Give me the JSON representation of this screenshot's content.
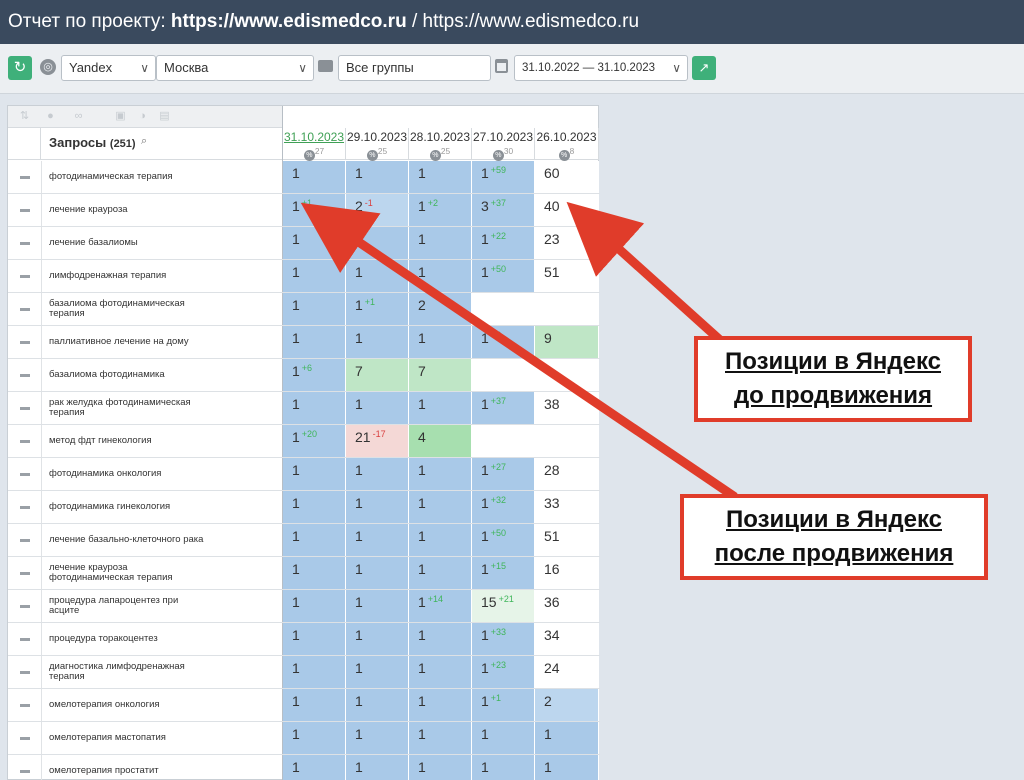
{
  "header": {
    "prefix": "Отчет по проекту: ",
    "project_bold": "https://www.edismedco.ru",
    "separator": " / ",
    "project_plain": "https://www.edismedco.ru"
  },
  "toolbar": {
    "search_engine": "Yandex",
    "region": "Москва",
    "group": "Все группы",
    "date_range": "31.10.2022 — 31.10.2023"
  },
  "table": {
    "queries_title": "Запросы",
    "queries_count": "(251)",
    "dates": [
      {
        "date": "31.10.2023",
        "pct": "27"
      },
      {
        "date": "29.10.2023",
        "pct": "25"
      },
      {
        "date": "28.10.2023",
        "pct": "25"
      },
      {
        "date": "27.10.2023",
        "pct": "30"
      },
      {
        "date": "26.10.2023",
        "pct": "8"
      }
    ],
    "rows": [
      {
        "query": "фотодинамическая терапия",
        "cells": [
          {
            "v": "1",
            "c": "b"
          },
          {
            "v": "1",
            "c": "b"
          },
          {
            "v": "1",
            "c": "b"
          },
          {
            "v": "1",
            "d": "+59",
            "c": "b"
          },
          {
            "v": "60",
            "c": "w"
          }
        ]
      },
      {
        "query": "лечение крауроза",
        "cells": [
          {
            "v": "1",
            "d": "+1",
            "c": "b"
          },
          {
            "v": "2",
            "d": "-1",
            "c": "lb"
          },
          {
            "v": "1",
            "d": "+2",
            "c": "b"
          },
          {
            "v": "3",
            "d": "+37",
            "c": "b"
          },
          {
            "v": "40",
            "c": "w"
          }
        ]
      },
      {
        "query": "лечение базалиомы",
        "cells": [
          {
            "v": "1",
            "c": "b"
          },
          {
            "v": "1",
            "c": "b"
          },
          {
            "v": "1",
            "c": "b"
          },
          {
            "v": "1",
            "d": "+22",
            "c": "b"
          },
          {
            "v": "23",
            "c": "w"
          }
        ]
      },
      {
        "query": "лимфодренажная терапия",
        "cells": [
          {
            "v": "1",
            "c": "b"
          },
          {
            "v": "1",
            "c": "b"
          },
          {
            "v": "1",
            "c": "b"
          },
          {
            "v": "1",
            "d": "+50",
            "c": "b"
          },
          {
            "v": "51",
            "c": "w"
          }
        ]
      },
      {
        "query": "базалиома фотодинамическая терапия",
        "cells": [
          {
            "v": "1",
            "c": "b"
          },
          {
            "v": "1",
            "d": "+1",
            "c": "b"
          },
          {
            "v": "2",
            "c": "b"
          },
          {
            "v": "",
            "c": "w"
          },
          {
            "v": "",
            "c": "w"
          }
        ]
      },
      {
        "query": "паллиативное лечение на дому",
        "cells": [
          {
            "v": "1",
            "c": "b"
          },
          {
            "v": "1",
            "c": "b"
          },
          {
            "v": "1",
            "c": "b"
          },
          {
            "v": "1",
            "d": "+8",
            "c": "b"
          },
          {
            "v": "9",
            "c": "g"
          }
        ]
      },
      {
        "query": "базалиома фотодинамика",
        "cells": [
          {
            "v": "1",
            "d": "+6",
            "c": "b"
          },
          {
            "v": "7",
            "c": "g"
          },
          {
            "v": "7",
            "c": "g"
          },
          {
            "v": "",
            "c": "w"
          },
          {
            "v": "",
            "c": "w"
          }
        ]
      },
      {
        "query": "рак желудка фотодинамическая терапия",
        "cells": [
          {
            "v": "1",
            "c": "b"
          },
          {
            "v": "1",
            "c": "b"
          },
          {
            "v": "1",
            "c": "b"
          },
          {
            "v": "1",
            "d": "+37",
            "c": "b"
          },
          {
            "v": "38",
            "c": "w"
          }
        ]
      },
      {
        "query": "метод фдт гинекология",
        "cells": [
          {
            "v": "1",
            "d": "+20",
            "c": "b"
          },
          {
            "v": "21",
            "d": "-17",
            "c": "r"
          },
          {
            "v": "4",
            "c": "dg"
          },
          {
            "v": "",
            "c": "w"
          },
          {
            "v": "",
            "c": "w"
          }
        ]
      },
      {
        "query": "фотодинамика онкология",
        "cells": [
          {
            "v": "1",
            "c": "b"
          },
          {
            "v": "1",
            "c": "b"
          },
          {
            "v": "1",
            "c": "b"
          },
          {
            "v": "1",
            "d": "+27",
            "c": "b"
          },
          {
            "v": "28",
            "c": "w"
          }
        ]
      },
      {
        "query": "фотодинамика гинекология",
        "cells": [
          {
            "v": "1",
            "c": "b"
          },
          {
            "v": "1",
            "c": "b"
          },
          {
            "v": "1",
            "c": "b"
          },
          {
            "v": "1",
            "d": "+32",
            "c": "b"
          },
          {
            "v": "33",
            "c": "w"
          }
        ]
      },
      {
        "query": "лечение базально-клеточного рака",
        "cells": [
          {
            "v": "1",
            "c": "b"
          },
          {
            "v": "1",
            "c": "b"
          },
          {
            "v": "1",
            "c": "b"
          },
          {
            "v": "1",
            "d": "+50",
            "c": "b"
          },
          {
            "v": "51",
            "c": "w"
          }
        ]
      },
      {
        "query": "лечение крауроза фотодинамическая терапия",
        "cells": [
          {
            "v": "1",
            "c": "b"
          },
          {
            "v": "1",
            "c": "b"
          },
          {
            "v": "1",
            "c": "b"
          },
          {
            "v": "1",
            "d": "+15",
            "c": "b"
          },
          {
            "v": "16",
            "c": "w"
          }
        ]
      },
      {
        "query": "процедура лапароцентез при асците",
        "cells": [
          {
            "v": "1",
            "c": "b"
          },
          {
            "v": "1",
            "c": "b"
          },
          {
            "v": "1",
            "d": "+14",
            "c": "b"
          },
          {
            "v": "15",
            "d": "+21",
            "c": "lg"
          },
          {
            "v": "36",
            "c": "w"
          }
        ]
      },
      {
        "query": "процедура торакоцентез",
        "cells": [
          {
            "v": "1",
            "c": "b"
          },
          {
            "v": "1",
            "c": "b"
          },
          {
            "v": "1",
            "c": "b"
          },
          {
            "v": "1",
            "d": "+33",
            "c": "b"
          },
          {
            "v": "34",
            "c": "w"
          }
        ]
      },
      {
        "query": "диагностика лимфодренажная терапия",
        "cells": [
          {
            "v": "1",
            "c": "b"
          },
          {
            "v": "1",
            "c": "b"
          },
          {
            "v": "1",
            "c": "b"
          },
          {
            "v": "1",
            "d": "+23",
            "c": "b"
          },
          {
            "v": "24",
            "c": "w"
          }
        ]
      },
      {
        "query": "омелотерапия онкология",
        "cells": [
          {
            "v": "1",
            "c": "b"
          },
          {
            "v": "1",
            "c": "b"
          },
          {
            "v": "1",
            "c": "b"
          },
          {
            "v": "1",
            "d": "+1",
            "c": "b"
          },
          {
            "v": "2",
            "c": "lb"
          }
        ]
      },
      {
        "query": "омелотерапия мастопатия",
        "cells": [
          {
            "v": "1",
            "c": "b"
          },
          {
            "v": "1",
            "c": "b"
          },
          {
            "v": "1",
            "c": "b"
          },
          {
            "v": "1",
            "c": "b"
          },
          {
            "v": "1",
            "c": "b"
          }
        ]
      },
      {
        "query": "омелотерапия простатит",
        "cells": [
          {
            "v": "1",
            "c": "b"
          },
          {
            "v": "1",
            "c": "b"
          },
          {
            "v": "1",
            "c": "b"
          },
          {
            "v": "1",
            "c": "b"
          },
          {
            "v": "1",
            "c": "b"
          }
        ]
      }
    ]
  },
  "callouts": {
    "before_line1": "Позиции в Яндекс",
    "before_line2": "до продвижения",
    "after_line1": "Позиции в Яндекс",
    "after_line2": "после продвижения"
  },
  "colors": {
    "b": "#a9c9e8",
    "lb": "#bcd6ee",
    "w": "#ffffff",
    "g": "#bfe6c6",
    "dg": "#a7dfaf",
    "lg": "#e6f4e8",
    "r": "#f4d8d6",
    "accent_red": "#e03c2a"
  }
}
